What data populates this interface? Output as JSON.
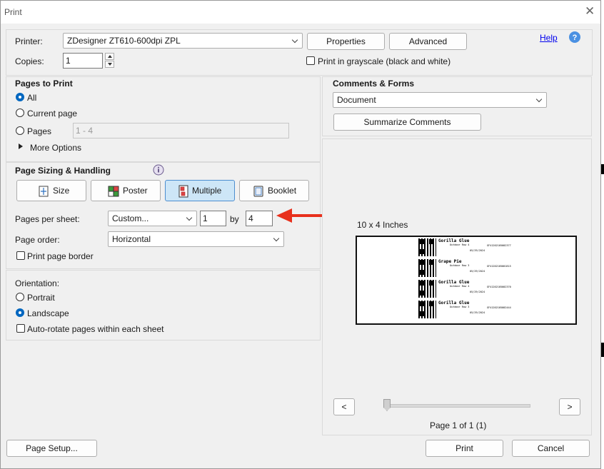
{
  "window": {
    "title": "Print"
  },
  "header": {
    "printer_label": "Printer:",
    "printer_value": "ZDesigner ZT610-600dpi ZPL",
    "properties_label": "Properties",
    "advanced_label": "Advanced",
    "help_label": "Help",
    "copies_label": "Copies:",
    "copies_value": "1",
    "grayscale_label": "Print in grayscale (black and white)"
  },
  "pages_to_print": {
    "title": "Pages to Print",
    "all_label": "All",
    "current_label": "Current page",
    "pages_label": "Pages",
    "pages_value": "1 - 4",
    "more_options_label": "More Options"
  },
  "sizing": {
    "title": "Page Sizing & Handling",
    "buttons": {
      "size": "Size",
      "poster": "Poster",
      "multiple": "Multiple",
      "booklet": "Booklet"
    },
    "pages_per_sheet_label": "Pages per sheet:",
    "pages_per_sheet_value": "Custom...",
    "cols_value": "1",
    "by_label": "by",
    "rows_value": "4",
    "page_order_label": "Page order:",
    "page_order_value": "Horizontal",
    "print_border_label": "Print page border"
  },
  "orientation": {
    "title": "Orientation:",
    "portrait_label": "Portrait",
    "landscape_label": "Landscape",
    "autorotate_label": "Auto-rotate pages within each sheet"
  },
  "comments": {
    "title": "Comments & Forms",
    "value": "Document",
    "summarize_label": "Summarize Comments"
  },
  "preview": {
    "size_label": "10 x 4 Inches",
    "labels": [
      {
        "name": "Gorilla Glue",
        "sub": "Outdoor Row 4",
        "code": "GF41202105002377",
        "date": "05/29/2024"
      },
      {
        "name": "Grape Pie",
        "sub": "Outdoor Row 3",
        "code": "GF41202105001815",
        "date": "05/29/2024"
      },
      {
        "name": "Gorilla Glue",
        "sub": "Outdoor Row 4",
        "code": "GF41202105002370",
        "date": "05/29/2024"
      },
      {
        "name": "Gorilla Glue",
        "sub": "Outdoor Row 3",
        "code": "GF41202105002444",
        "date": "05/29/2024"
      }
    ],
    "prev_label": "<",
    "next_label": ">",
    "page_status": "Page 1 of 1 (1)"
  },
  "footer": {
    "page_setup_label": "Page Setup...",
    "print_label": "Print",
    "cancel_label": "Cancel"
  },
  "colors": {
    "accent": "#0067c0",
    "annotation_arrow": "#e8301c",
    "active_button": "#cde6f7"
  }
}
